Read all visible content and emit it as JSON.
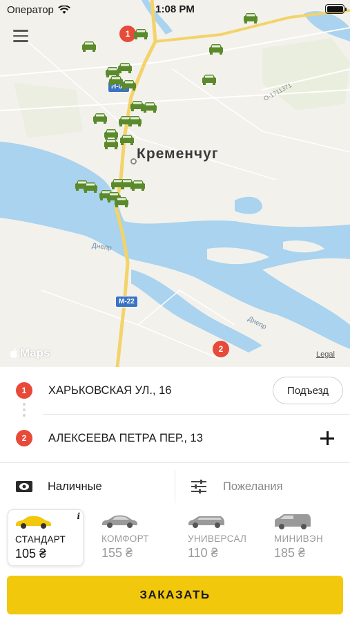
{
  "status_bar": {
    "carrier": "Оператор",
    "time": "1:08 PM"
  },
  "map": {
    "city": "Кременчуг",
    "river_label_1": "Днепр",
    "river_label_2": "Днепр",
    "road_tag_1": "Н-08",
    "road_tag_2": "М-22",
    "road_code": "О-1711371",
    "maps_brand": "Maps",
    "legal": "Legal",
    "pins": [
      "1",
      "2"
    ],
    "car_color": "#5a8a2c"
  },
  "route": {
    "from": {
      "number": "1",
      "address": "ХАРЬКОВСКАЯ УЛ., 16"
    },
    "to": {
      "number": "2",
      "address": "АЛЕКСЕЕВА ПЕТРА ПЕР., 13"
    },
    "entrance_label": "Подъезд",
    "add_stop_icon": "plus-icon"
  },
  "options": {
    "payment": {
      "icon": "cash-icon",
      "label": "Наличные"
    },
    "wishes": {
      "icon": "sliders-icon",
      "label": "Пожелания"
    }
  },
  "tariffs": [
    {
      "name": "СТАНДАРТ",
      "price": "105 ₴",
      "selected": true,
      "icon": "sedan-icon"
    },
    {
      "name": "КОМФОРТ",
      "price": "155 ₴",
      "selected": false,
      "icon": "sedan-icon"
    },
    {
      "name": "УНИВЕРСАЛ",
      "price": "110 ₴",
      "selected": false,
      "icon": "wagon-icon"
    },
    {
      "name": "МИНИВЭН",
      "price": "185 ₴",
      "selected": false,
      "icon": "minivan-icon"
    }
  ],
  "tariff_info": "i",
  "order_label": "ЗАКАЗАТЬ",
  "colors": {
    "accent": "#f2c80c",
    "pin": "#e84a3a",
    "water": "#a9d3ee",
    "road": "#f3d36a"
  }
}
